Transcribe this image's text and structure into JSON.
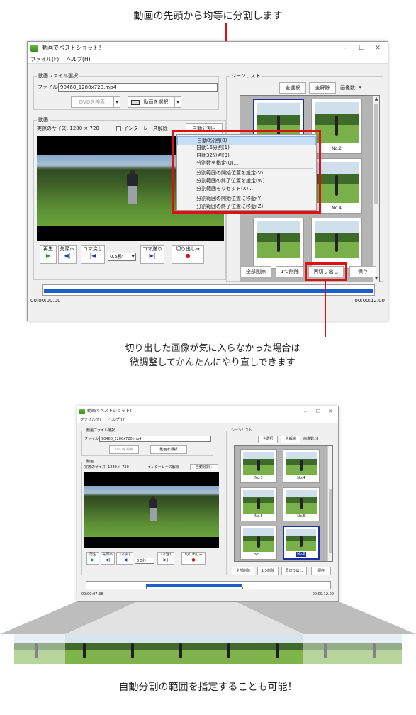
{
  "captions": {
    "top": "動画の先頭から均等に分割します",
    "mid_line1": "切り出した画像が気に入らなかった場合は",
    "mid_line2": "微調整してかんたんにやり直しできます",
    "bottom": "自動分割の範囲を指定することも可能！"
  },
  "app": {
    "title": "動画でベストショット！",
    "window_controls": {
      "minimize": "–",
      "maximize": "☐",
      "close": "✕"
    },
    "menu": [
      "ファイル(F)",
      "ヘルプ(H)"
    ],
    "file_group": {
      "label": "動画ファイル選択",
      "file_name_label": "ファイル名",
      "file_name_value": "90468_1280x720.mp4",
      "dvd_button": "DVDを検索",
      "dvd_dropdown": "▾",
      "select_video_button": "動画を選択",
      "select_dropdown": "▾"
    },
    "video_group": {
      "label": "動画",
      "size_label": "実際のサイズ: 1280 × 720",
      "interlace_label": "インターレース解除",
      "auto_split_button": "自動分割⇒"
    },
    "controls": {
      "play": {
        "label": "再生",
        "icon": "▶"
      },
      "to_start": {
        "label": "先頭へ",
        "icon": "◀|"
      },
      "frame_back": {
        "label": "コマ戻し",
        "icon": "|◀"
      },
      "interval": "0.5秒",
      "frame_forward": {
        "label": "コマ送り",
        "icon": "▶|"
      },
      "cut_out": {
        "label": "切り出し⇒",
        "icon": "●"
      }
    },
    "scene_group": {
      "label": "シーンリスト",
      "select_all": "全選択",
      "deselect_all": "全解除",
      "count_label": "画像数: 8"
    },
    "scenes_top": [
      {
        "label": "",
        "selected": true
      },
      {
        "label": "No.2",
        "selected": false
      },
      {
        "label": "",
        "selected": false
      },
      {
        "label": "No.4",
        "selected": false
      },
      {
        "label": "",
        "selected": false
      },
      {
        "label": "",
        "selected": false
      }
    ],
    "scene_buttons": {
      "delete_all": "全部削除",
      "delete_one": "1つ削除",
      "recut": "再切り出し",
      "save": "保存"
    },
    "timeline": {
      "start": "00:00:00.00",
      "end": "00:00:12.00"
    },
    "context_menu": [
      "自動8分割(8)",
      "自動16分割(1)",
      "自動32分割(3)",
      "分割数を指定(U)...",
      "分割範囲の開始位置を設定(V)...",
      "分割範囲の終了位置を設定(W)...",
      "分割範囲をリセット(X)...",
      "分割範囲の開始位置に移動(Y)",
      "分割範囲の終了位置に移動(Z)"
    ]
  },
  "app2": {
    "scenes": [
      {
        "label": "No.3",
        "selected": false
      },
      {
        "label": "No.4",
        "selected": false
      },
      {
        "label": "No.5",
        "selected": false
      },
      {
        "label": "No.6",
        "selected": false
      },
      {
        "label": "No.7",
        "selected": false
      },
      {
        "label": "No.8",
        "selected": true
      }
    ],
    "timeline": {
      "start": "00:00:07.38",
      "end": "00:00:12.00"
    }
  },
  "colors": {
    "accent_red": "#e01010",
    "timeline_blue": "#1a5fcf",
    "selection_navy": "#1a2fa0"
  }
}
